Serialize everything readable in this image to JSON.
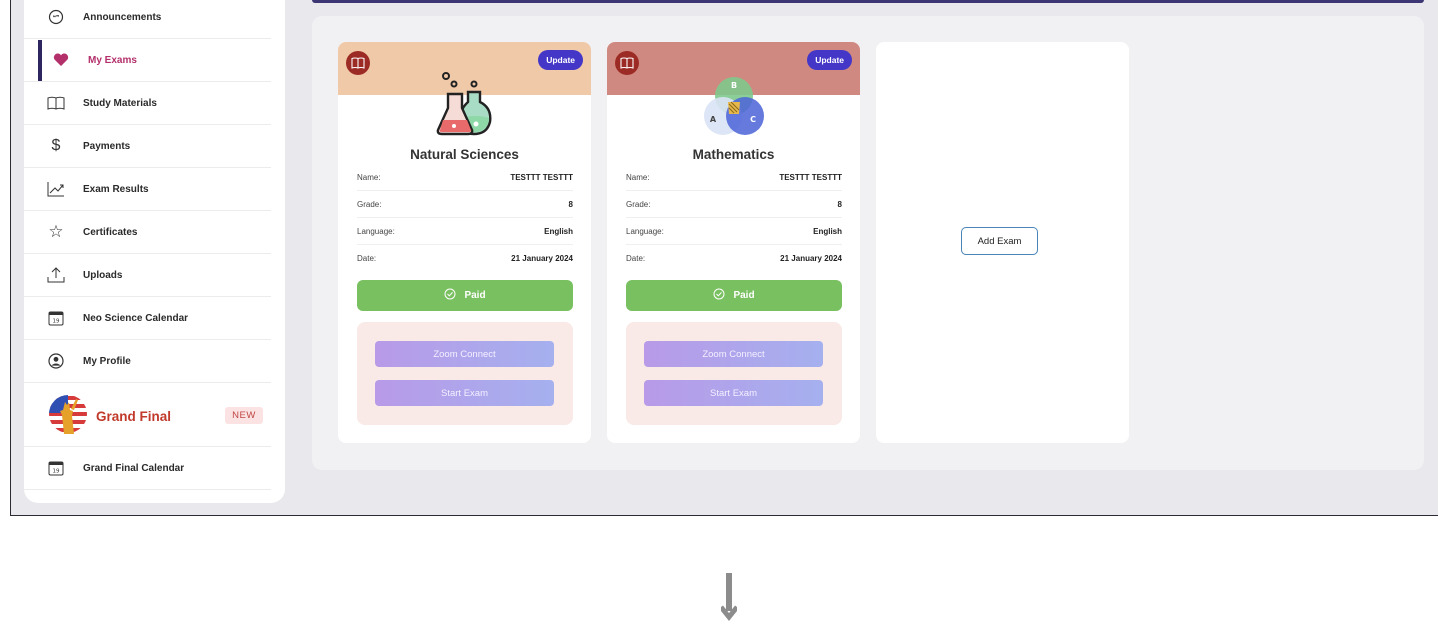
{
  "sidebar": {
    "items": [
      {
        "label": "Announcements",
        "icon": "megaphone-icon"
      },
      {
        "label": "My Exams",
        "icon": "heart-icon",
        "active": true
      },
      {
        "label": "Study Materials",
        "icon": "book-icon"
      },
      {
        "label": "Payments",
        "icon": "dollar-icon"
      },
      {
        "label": "Exam Results",
        "icon": "chart-line-icon"
      },
      {
        "label": "Certificates",
        "icon": "star-icon"
      },
      {
        "label": "Uploads",
        "icon": "upload-icon"
      },
      {
        "label": "Neo Science Calendar",
        "icon": "calendar-icon",
        "calendar_day": "19"
      },
      {
        "label": "My Profile",
        "icon": "user-circle-icon"
      }
    ],
    "grand_final": {
      "label": "Grand Final",
      "badge": "NEW",
      "icon": "liberty-flag-icon"
    },
    "grand_final_calendar": {
      "label": "Grand Final Calendar",
      "icon": "calendar-icon",
      "calendar_day": "19"
    }
  },
  "exams": [
    {
      "subject": "Natural Sciences",
      "header_color": "#f0c9a9",
      "update_label": "Update",
      "rows": [
        {
          "key": "Name:",
          "value": "TESTTT TESTTT"
        },
        {
          "key": "Grade:",
          "value": "8"
        },
        {
          "key": "Language:",
          "value": "English"
        },
        {
          "key": "Date:",
          "value": "21 January 2024"
        }
      ],
      "status_label": "Paid",
      "zoom_label": "Zoom Connect",
      "start_label": "Start Exam"
    },
    {
      "subject": "Mathematics",
      "header_color": "#d08980",
      "update_label": "Update",
      "venn_labels": [
        "A",
        "B",
        "C"
      ],
      "rows": [
        {
          "key": "Name:",
          "value": "TESTTT TESTTT"
        },
        {
          "key": "Grade:",
          "value": "8"
        },
        {
          "key": "Language:",
          "value": "English"
        },
        {
          "key": "Date:",
          "value": "21 January 2024"
        }
      ],
      "status_label": "Paid",
      "zoom_label": "Zoom Connect",
      "start_label": "Start Exam"
    }
  ],
  "add_exam_label": "Add Exam",
  "colors": {
    "accent_active": "#b4306b",
    "update_badge": "#4437c8",
    "paid": "#79c060",
    "active_bar": "#2e2660"
  }
}
